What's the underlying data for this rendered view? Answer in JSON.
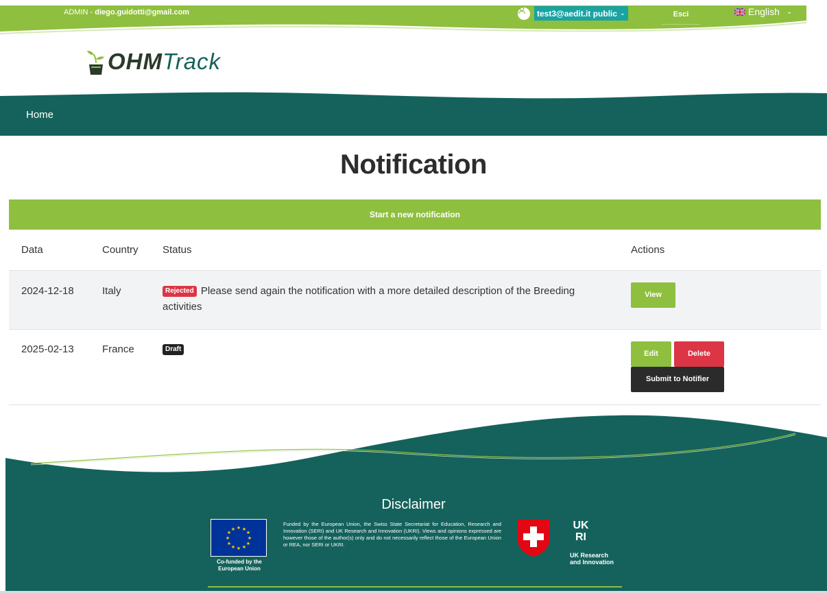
{
  "colors": {
    "brand_green": "#8fbf3f",
    "teal": "#15625c",
    "danger": "#dc3545",
    "dark": "#2b2b2b",
    "user_select_bg": "#1aa3a3"
  },
  "topbar": {
    "admin_prefix": "ADMIN - ",
    "admin_email": "diego.guidotti@gmail.com",
    "user_icon": "user-icon",
    "user_select": "test3@aedit.it public",
    "logout_label": "Esci",
    "language_label": "English",
    "language_flag": "uk-flag-icon"
  },
  "logo": {
    "part1": "OHM",
    "part2": "Track"
  },
  "nav": {
    "home": "Home"
  },
  "page": {
    "title": "Notification",
    "new_button": "Start a new notification"
  },
  "table": {
    "headers": {
      "data": "Data",
      "country": "Country",
      "status": "Status",
      "actions": "Actions"
    },
    "rows": [
      {
        "date": "2024-12-18",
        "country": "Italy",
        "badge": "Rejected",
        "message": "Please send again the notification with a more detailed description of the Breeding activities",
        "actions": [
          "View"
        ]
      },
      {
        "date": "2025-02-13",
        "country": "France",
        "badge": "Draft",
        "message": "",
        "actions": [
          "Edit",
          "Delete",
          "Submit to Notifier"
        ]
      }
    ]
  },
  "footer": {
    "disclaimer_title": "Disclaimer",
    "eu_caption": "Co-funded by the European Union",
    "funding_text": "Funded by the European Union, the Swiss State Secretariat for Education, Research and Innovation (SERI) and UK Research and Innovation (UKRI). Views and opinions expressed are however those of the author(s) only and do not necessarily reflect those of the European Union or REA, nor SERI or UKRI.",
    "ukri_caption_line1": "UK Research",
    "ukri_caption_line2": "and Innovation"
  }
}
